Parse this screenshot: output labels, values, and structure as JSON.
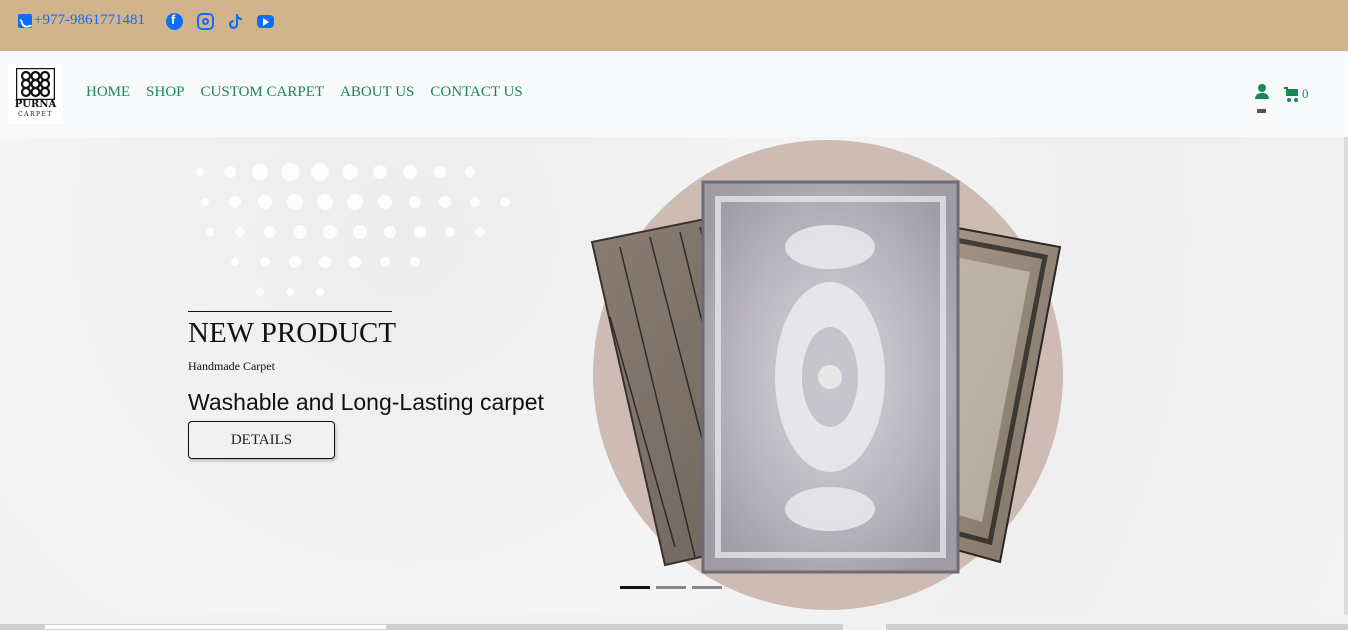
{
  "topbar": {
    "phone": "+977-9861771481",
    "socials": [
      "facebook-icon",
      "instagram-icon",
      "tiktok-icon",
      "youtube-icon"
    ],
    "bg_color": "#d2b48c",
    "link_color": "#0d6efd"
  },
  "brand": {
    "name": "PURNA",
    "sub": "CARPET"
  },
  "nav": {
    "items": [
      "HOME",
      "SHOP",
      "CUSTOM CARPET",
      "ABOUT US",
      "CONTACT US"
    ],
    "cart_count": "0",
    "link_color": "#198754"
  },
  "hero": {
    "title": "NEW PRODUCT",
    "subtitle": "Handmade Carpet",
    "tagline": "Washable and Long-Lasting carpet",
    "button": "DETAILS",
    "active_slide": 1,
    "slide_count": 3,
    "circle_color": "#cdbbb4"
  }
}
